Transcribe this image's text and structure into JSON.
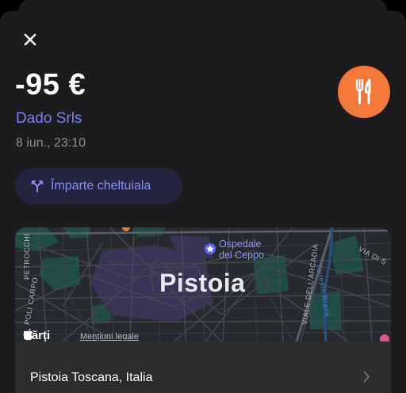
{
  "transaction": {
    "amount": "-95 €",
    "merchant": "Dado Srls",
    "datetime": "8 iun., 23:10",
    "category_icon": "fork-knife-icon",
    "category_color": "#f2793a"
  },
  "actions": {
    "close_icon": "close-icon",
    "split_label": "Împarte cheltuiala",
    "split_icon": "split-arrows-icon"
  },
  "map": {
    "city": "Pistoia",
    "poi_name_line1": "Ospedale",
    "poi_name_line2": "del Ceppo",
    "streets": {
      "petrocchi": "PETROCCHI",
      "carpo": "POLI CARPO",
      "arcadia": "VIALE DELL'ARCADIA",
      "torrente": "Torrente Brana",
      "via_di": "VIA DI S"
    },
    "provider": "Hărți",
    "legal": "Mențiuni legale",
    "address": "Pistoia Toscana, Italia"
  },
  "colors": {
    "accent": "#7b7ff6",
    "sheet": "#1c1c1e",
    "card": "#2c2c2e"
  }
}
